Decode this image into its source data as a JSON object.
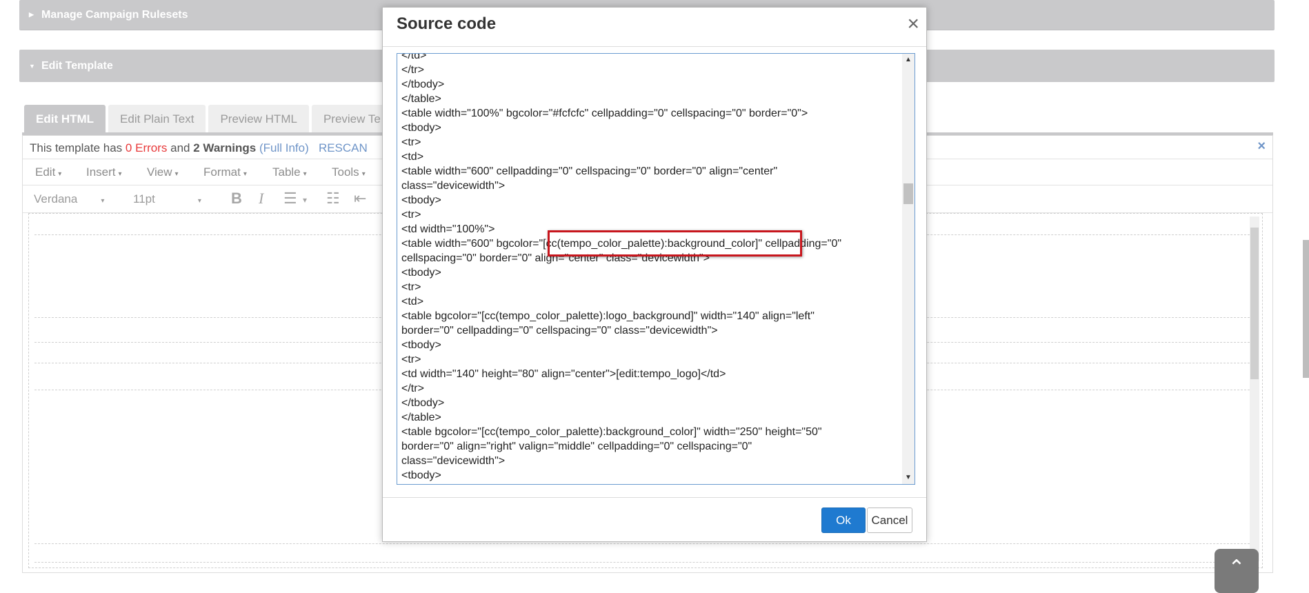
{
  "panels": {
    "rulesets": "Manage Campaign Rulesets",
    "edit_template": "Edit Template"
  },
  "tabs": [
    {
      "label": "Edit HTML",
      "active": true
    },
    {
      "label": "Edit Plain Text",
      "active": false
    },
    {
      "label": "Preview HTML",
      "active": false
    },
    {
      "label": "Preview Te",
      "active": false
    }
  ],
  "status": {
    "prefix": "This template has",
    "errors": "0 Errors",
    "and": "and",
    "warnings": "2 Warnings",
    "full_info": "(Full Info)",
    "rescan": "RESCAN",
    "close_icon": "×"
  },
  "menu": [
    "Edit",
    "Insert",
    "View",
    "Format",
    "Table",
    "Tools"
  ],
  "toolbar": {
    "font": "Verdana",
    "size": "11pt",
    "bold": "B",
    "italic": "I"
  },
  "modal": {
    "title": "Source code",
    "close": "×",
    "code": "</td>\n</tr>\n</tbody>\n</table>\n<table width=\"100%\" bgcolor=\"#fcfcfc\" cellpadding=\"0\" cellspacing=\"0\" border=\"0\">\n<tbody>\n<tr>\n<td>\n<table width=\"600\" cellpadding=\"0\" cellspacing=\"0\" border=\"0\" align=\"center\"\nclass=\"devicewidth\">\n<tbody>\n<tr>\n<td width=\"100%\">\n<table width=\"600\" bgcolor=\"[cc(tempo_color_palette):background_color]\" cellpadding=\"0\"\ncellspacing=\"0\" border=\"0\" align=\"center\" class=\"devicewidth\">\n<tbody>\n<tr>\n<td>\n<table bgcolor=\"[cc(tempo_color_palette):logo_background]\" width=\"140\" align=\"left\"\nborder=\"0\" cellpadding=\"0\" cellspacing=\"0\" class=\"devicewidth\">\n<tbody>\n<tr>\n<td width=\"140\" height=\"80\" align=\"center\">[edit:tempo_logo]</td>\n</tr>\n</tbody>\n</table>\n<table bgcolor=\"[cc(tempo_color_palette):background_color]\" width=\"250\" height=\"50\"\nborder=\"0\" align=\"right\" valign=\"middle\" cellpadding=\"0\" cellspacing=\"0\"\nclass=\"devicewidth\">\n<tbody>",
    "ok": "Ok",
    "cancel": "Cancel"
  }
}
